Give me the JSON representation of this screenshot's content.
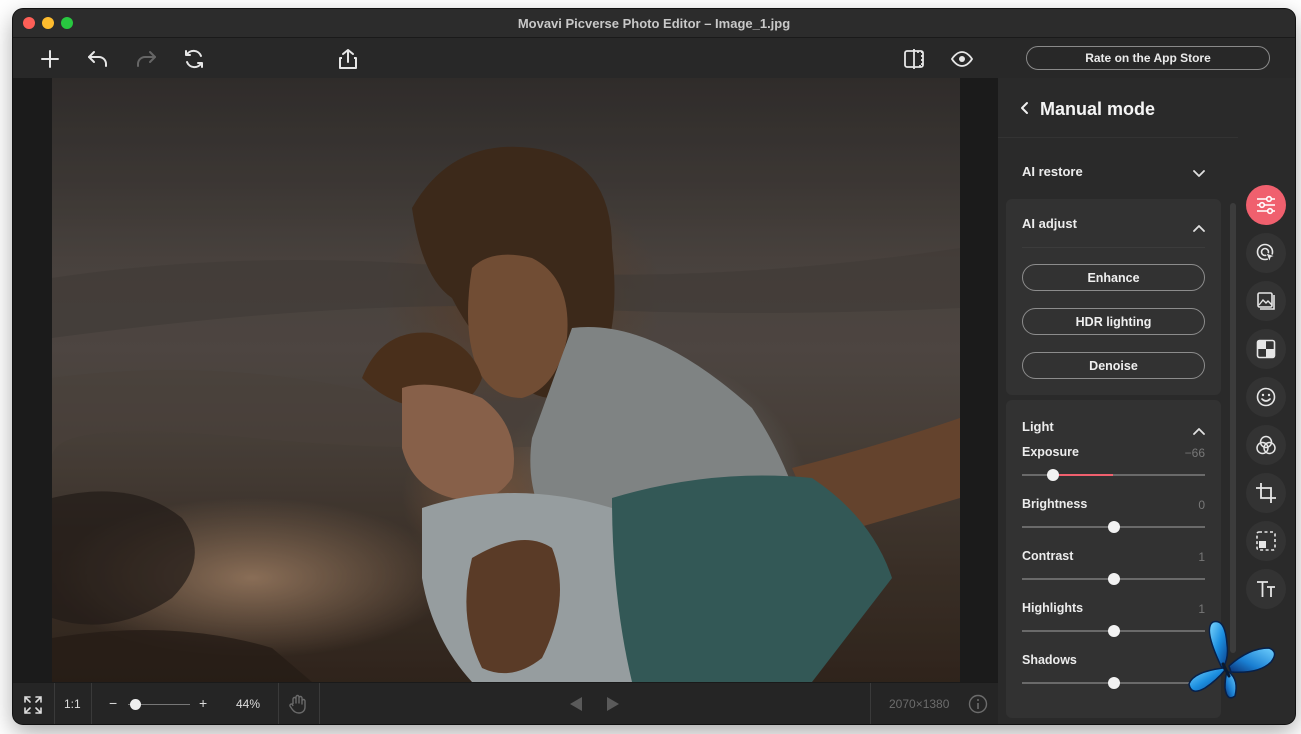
{
  "window": {
    "title": "Movavi Picverse Photo Editor – Image_1.jpg"
  },
  "toolbar": {
    "icons": [
      "plus-icon",
      "undo-icon",
      "redo-icon",
      "reset-icon",
      "share-icon",
      "compare-icon",
      "preview-eye-icon"
    ],
    "rate_label": "Rate on the App Store"
  },
  "panel": {
    "title": "Manual mode",
    "ai_restore": {
      "label": "AI restore",
      "expanded": false
    },
    "ai_adjust": {
      "label": "AI adjust",
      "expanded": true,
      "buttons": [
        "Enhance",
        "HDR lighting",
        "Denoise"
      ]
    },
    "light": {
      "label": "Light",
      "expanded": true,
      "sliders": [
        {
          "label": "Exposure",
          "value": "−66",
          "level": -0.66
        },
        {
          "label": "Brightness",
          "value": "0",
          "level": 0
        },
        {
          "label": "Contrast",
          "value": "1",
          "level": 0.01
        },
        {
          "label": "Highlights",
          "value": "1",
          "level": 0.01
        },
        {
          "label": "Shadows",
          "value": "",
          "level": 0
        }
      ]
    }
  },
  "rail": {
    "tools": [
      "adjust-sliders-icon",
      "ai-select-icon",
      "image-icon",
      "checker-icon",
      "smiley-icon",
      "color-filters-icon",
      "crop-icon",
      "selection-icon",
      "text-icon"
    ],
    "active": "adjust-sliders-icon"
  },
  "bottombar": {
    "fit_icon": "fullscreen-icon",
    "one_to_one": "1:1",
    "zoom_minus": "−",
    "zoom_plus": "+",
    "zoom_value": "44%",
    "zoom_level": 0.05,
    "dimensions": "2070×1380"
  },
  "colors": {
    "accent": "#f0606e",
    "background": "#252525",
    "panel": "#2a2a2a"
  }
}
